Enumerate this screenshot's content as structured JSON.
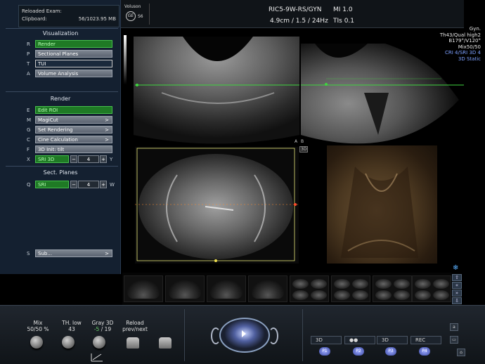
{
  "clipboard": {
    "line1": "Reloaded Exam:",
    "line2": "Clipboard:",
    "value": "56/1023.95 MB"
  },
  "visualization": {
    "title": "Visualization",
    "items": [
      {
        "key": "R",
        "label": "Render",
        "style": "green"
      },
      {
        "key": "P",
        "label": "Sectional Planes",
        "style": "normal"
      },
      {
        "key": "T",
        "label": "TUI",
        "style": "outline"
      },
      {
        "key": "A",
        "label": "Volume Analysis",
        "style": "normal"
      }
    ]
  },
  "render": {
    "title": "Render",
    "items": [
      {
        "key": "E",
        "label": "Edit ROI",
        "style": "green",
        "arrow": ""
      },
      {
        "key": "M",
        "label": "MagiCut",
        "style": "normal",
        "arrow": ">"
      },
      {
        "key": "G",
        "label": "Set Rendering",
        "style": "normal",
        "arrow": ">"
      },
      {
        "key": "C",
        "label": "Cine Calculation",
        "style": "normal",
        "arrow": ">"
      },
      {
        "key": "F",
        "label": "3D Init: tilt",
        "style": "normal",
        "arrow": ""
      }
    ],
    "sri": {
      "key": "X",
      "label": "SRI 3D",
      "minus": "−",
      "value": "4",
      "plus": "+",
      "right_key": "Y"
    }
  },
  "sect_planes": {
    "title": "Sect. Planes",
    "sri": {
      "key": "Q",
      "label": "SRI",
      "minus": "−",
      "value": "4",
      "plus": "+",
      "right_key": "W"
    }
  },
  "sub": {
    "key": "S",
    "label": "Sub...",
    "arrow": ">"
  },
  "header": {
    "brand": "Voluson",
    "logo": "GE",
    "model": "S6",
    "probe": "RIC5-9W-RS/GYN",
    "depth": "4.9cm / 1.5 / 24Hz",
    "mi": "MI  1.0",
    "tis": "TIs  0.1"
  },
  "params": [
    "Gyn.",
    "Th43/Qual high2",
    "B179°/V120°",
    "Mix50/50"
  ],
  "params_blue": [
    "CRI 4/SRI 3D 4",
    "3D Static"
  ],
  "quad_labels": {
    "a": "A",
    "b": "B",
    "d": "3D"
  },
  "bottom": {
    "mix": {
      "label": "Mix",
      "value": "50/50 %"
    },
    "th_low": {
      "label": "TH. low",
      "value": "43"
    },
    "gray3d": {
      "label": "Gray 3D",
      "value_green": "-5",
      "value_rest": " / 19"
    },
    "reload": {
      "label": "Reload",
      "value": "prev/next"
    },
    "presets": [
      {
        "label": "3D",
        "btn": "P1"
      },
      {
        "label": "●●",
        "btn": "P2"
      },
      {
        "label": "3D",
        "btn": "P3"
      },
      {
        "label": "REC",
        "btn": "P4"
      }
    ],
    "right_a": "a"
  },
  "icons": {
    "snowflake": "snowflake-icon",
    "arrow_up": "⇧",
    "arrow_double_up": "«",
    "arrow_down": "»",
    "arrow_double_down": "⇩"
  }
}
